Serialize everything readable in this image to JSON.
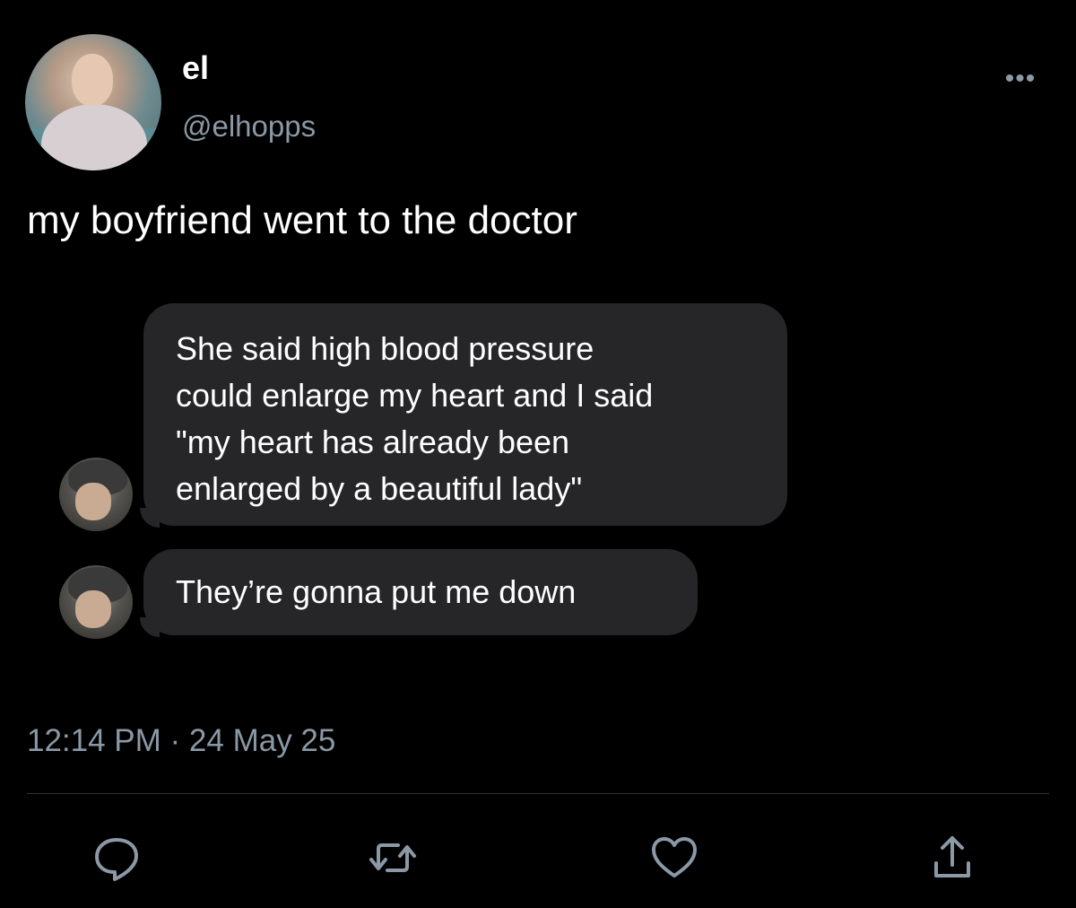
{
  "author": {
    "display_name": "el",
    "handle": "@elhopps",
    "avatar_icon": "profile-avatar"
  },
  "more_icon_label": "•••",
  "tweet": {
    "text": "my boyfriend went to the doctor",
    "timestamp": "12:14 PM · 24 May 25"
  },
  "chat": {
    "messages": [
      {
        "lines": [
          "She said high blood pressure",
          "could enlarge my heart and I said",
          "\"my heart has already been",
          "enlarged by a beautiful lady\""
        ]
      },
      {
        "lines": [
          "They’re gonna put me down"
        ]
      }
    ]
  },
  "actions": [
    {
      "icon": "reply-icon"
    },
    {
      "icon": "retweet-icon"
    },
    {
      "icon": "like-icon"
    },
    {
      "icon": "share-icon"
    }
  ],
  "colors": {
    "background": "#000000",
    "primary_text": "#ffffff",
    "secondary_text": "#8b98a5",
    "bubble": "#262628",
    "divider": "#2f3336"
  }
}
